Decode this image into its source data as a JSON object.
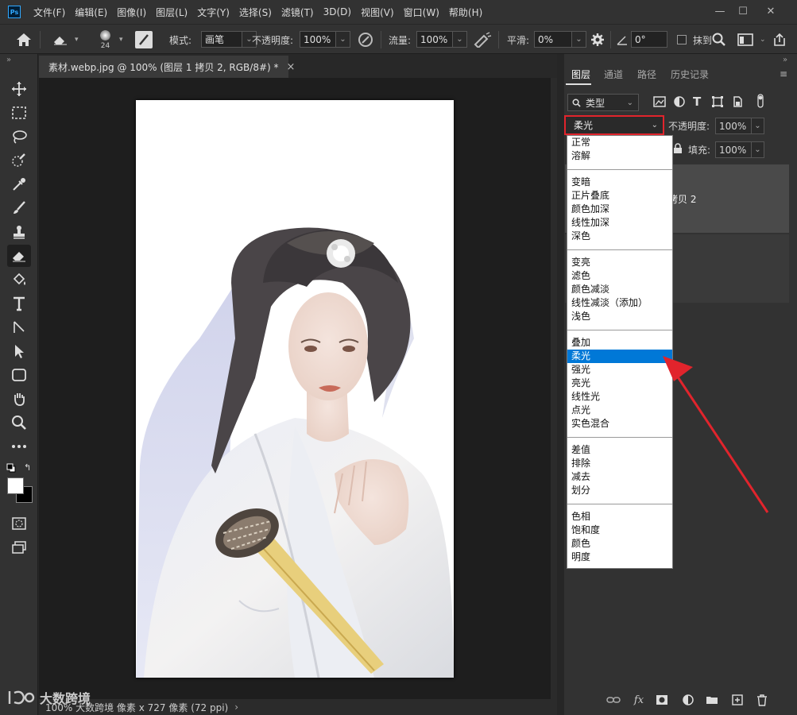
{
  "app": {
    "logo": "Ps"
  },
  "menubar": {
    "items": [
      "文件(F)",
      "编辑(E)",
      "图像(I)",
      "图层(L)",
      "文字(Y)",
      "选择(S)",
      "滤镜(T)",
      "3D(D)",
      "视图(V)",
      "窗口(W)",
      "帮助(H)"
    ],
    "minimize": "—",
    "maximize": "☐",
    "close": "✕"
  },
  "options": {
    "brush_size": "24",
    "mode_label": "模式:",
    "mode_value": "画笔",
    "opacity_label": "不透明度:",
    "opacity_value": "100%",
    "flow_label": "流量:",
    "flow_value": "100%",
    "smooth_label": "平滑:",
    "smooth_value": "0%",
    "angle_value": "0°",
    "erase_history_label": "抹到"
  },
  "document": {
    "tab_title": "素材.webp.jpg @ 100% (图层 1 拷贝 2, RGB/8#) *",
    "close": "×",
    "status_text": "100% 大数跨境 像素 x 727 像素 (72 ppi)",
    "watermark": "大数跨境"
  },
  "panel": {
    "tabs": [
      "图层",
      "通道",
      "路径",
      "历史记录"
    ],
    "filter_label": "类型",
    "blend_mode": "柔光",
    "opacity_label": "不透明度:",
    "opacity_value": "100%",
    "fill_label": "填充:",
    "fill_value": "100%",
    "layer_name_partial": "拷贝 2"
  },
  "blend_modes": {
    "groups": [
      [
        "正常",
        "溶解"
      ],
      [
        "变暗",
        "正片叠底",
        "颜色加深",
        "线性加深",
        "深色"
      ],
      [
        "变亮",
        "滤色",
        "颜色减淡",
        "线性减淡（添加）",
        "浅色"
      ],
      [
        "叠加",
        "柔光",
        "强光",
        "亮光",
        "线性光",
        "点光",
        "实色混合"
      ],
      [
        "差值",
        "排除",
        "减去",
        "划分"
      ],
      [
        "色相",
        "饱和度",
        "颜色",
        "明度"
      ]
    ],
    "selected": "柔光"
  },
  "colors": {
    "highlight": "#0078d7",
    "annotation": "#e1242c",
    "panel_bg": "#323232"
  }
}
